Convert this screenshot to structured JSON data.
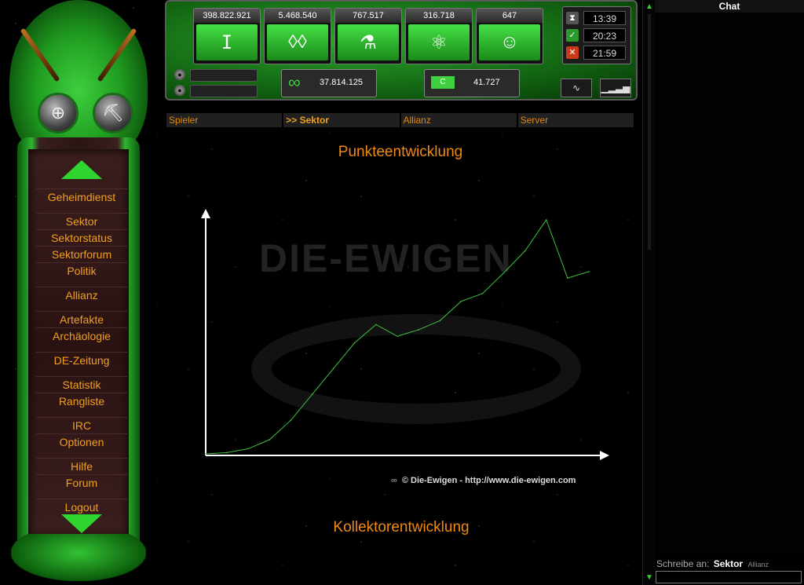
{
  "sidebar": {
    "menu": [
      {
        "label": "Geheimdienst"
      },
      {
        "label": "Sektor"
      },
      {
        "label": "Sektorstatus"
      },
      {
        "label": "Sektorforum"
      },
      {
        "label": "Politik"
      },
      {
        "label": "Allianz"
      },
      {
        "label": "Artefakte"
      },
      {
        "label": "Archäologie"
      },
      {
        "label": "DE-Zeitung"
      },
      {
        "label": "Statistik"
      },
      {
        "label": "Rangliste"
      },
      {
        "label": "IRC"
      },
      {
        "label": "Optionen"
      },
      {
        "label": "Hilfe"
      },
      {
        "label": "Forum"
      },
      {
        "label": "Logout"
      }
    ]
  },
  "resources": [
    {
      "value": "398.822.921",
      "icon": "metal-icon"
    },
    {
      "value": "5.468.540",
      "icon": "crystal-icon"
    },
    {
      "value": "767.517",
      "icon": "chemicals-icon"
    },
    {
      "value": "316.718",
      "icon": "atom-icon"
    },
    {
      "value": "647",
      "icon": "population-icon"
    }
  ],
  "clocks": [
    {
      "time": "13:39",
      "icon": "hourglass-icon",
      "color": "#555555"
    },
    {
      "time": "20:23",
      "icon": "check-icon",
      "color": "#2a9a2a"
    },
    {
      "time": "21:59",
      "icon": "cross-icon",
      "color": "#c83a1a"
    }
  ],
  "stats": {
    "score": "37.814.125",
    "collectors_label": "C",
    "collectors": "41.727"
  },
  "tabs": [
    {
      "label": "Spieler"
    },
    {
      "label": ">> Sektor"
    },
    {
      "label": "Allianz"
    },
    {
      "label": "Server"
    }
  ],
  "content": {
    "heading1": "Punkteentwicklung",
    "heading2": "Kollektorentwicklung",
    "watermark": "DIE-EWIGEN",
    "footer": "© Die-Ewigen  -  http://www.die-ewigen.com"
  },
  "chart_data": {
    "type": "line",
    "title": "Punkteentwicklung",
    "xlabel": "",
    "ylabel": "",
    "series": [
      {
        "values": [
          0,
          1,
          4,
          11,
          26,
          46,
          66,
          86,
          100,
          91,
          96,
          103,
          118,
          124,
          140,
          157,
          181,
          136,
          141
        ]
      }
    ],
    "color": "#3fbf3f",
    "grid": false
  },
  "chat": {
    "title": "Chat",
    "write_label": "Schreibe an:",
    "write_target": "Sektor",
    "write_alt": "Allianz",
    "input_value": ""
  }
}
